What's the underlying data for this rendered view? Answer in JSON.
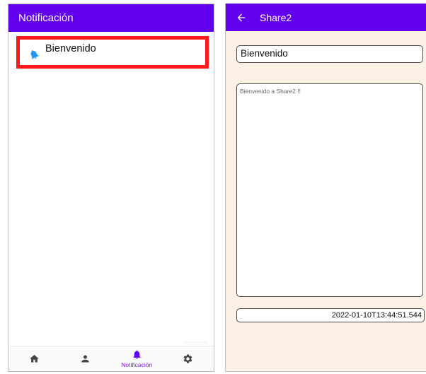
{
  "left_screen": {
    "appbar": {
      "title": "Notificación"
    },
    "notifications": [
      {
        "title": "Bienvenido",
        "icon": "bell-icon",
        "icon_color": "#2196f3"
      }
    ],
    "highlight_color": "#ff1a1a",
    "bottom_nav": {
      "items": [
        {
          "icon": "home-icon",
          "label": ""
        },
        {
          "icon": "person-icon",
          "label": ""
        },
        {
          "icon": "bell-icon",
          "label": "Notificación",
          "active": true
        },
        {
          "icon": "gear-icon",
          "label": ""
        }
      ],
      "active_color": "#7b1fe0",
      "inactive_color": "#424242"
    }
  },
  "right_screen": {
    "appbar": {
      "title": "Share2",
      "back_icon": "arrow-left-icon"
    },
    "title_field": {
      "value": "Bienvenido"
    },
    "body_field": {
      "value": "Bienvenido a Share2 !!"
    },
    "date_field": {
      "value": "2022-01-10T13:44:51.544"
    }
  },
  "colors": {
    "primary": "#6200ee",
    "background_right": "#fdf1e6"
  }
}
